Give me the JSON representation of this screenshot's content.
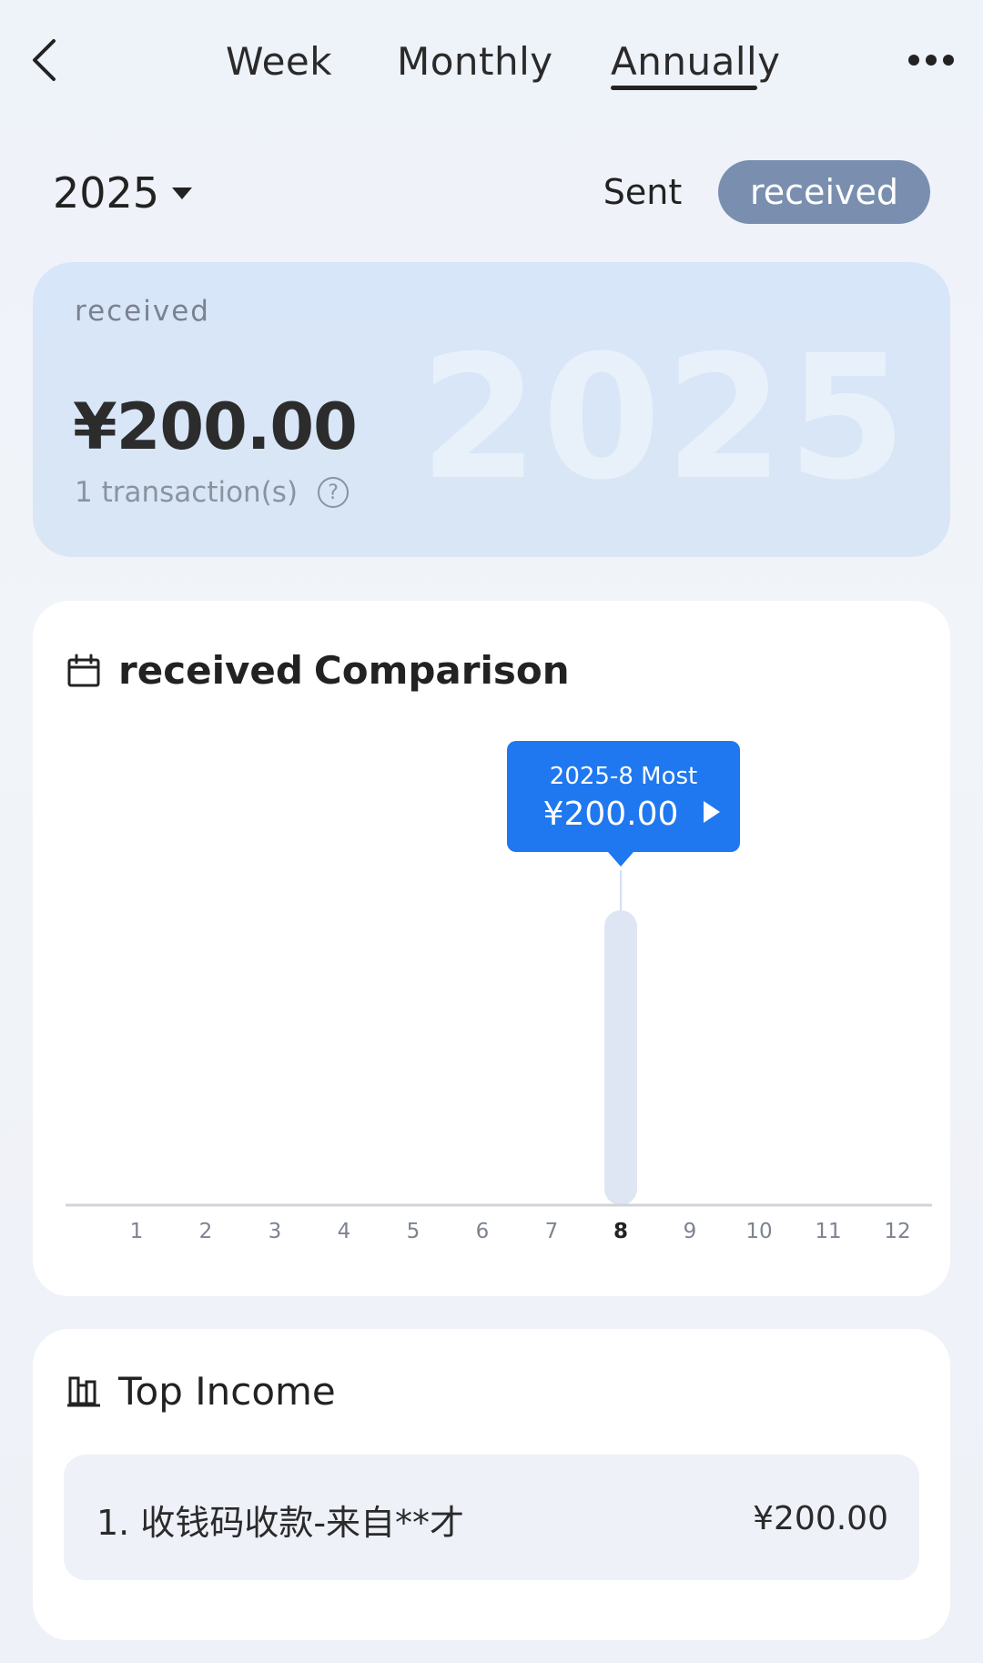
{
  "nav": {
    "tabs": [
      "Week",
      "Monthly",
      "Annually"
    ],
    "active_tab": "Annually",
    "back_icon": "chevron-left-icon",
    "more_icon": "more-dots-icon"
  },
  "filter": {
    "year": "2025",
    "toggle_sent": "Sent",
    "toggle_received": "received",
    "active_toggle": "received"
  },
  "summary": {
    "label": "received",
    "amount": "¥200.00",
    "count": "1 transaction(s)",
    "watermark": "2025",
    "help_icon": "?"
  },
  "comparison": {
    "title_prefix": "received",
    "title_suffix": "Comparison",
    "icon": "calendar-icon",
    "tooltip_line1": "2025-8 Most",
    "tooltip_line2": "¥200.00",
    "accent": "#1f78f0",
    "bar_color": "#dfe6f3"
  },
  "chart_data": {
    "type": "bar",
    "categories": [
      "1",
      "2",
      "3",
      "4",
      "5",
      "6",
      "7",
      "8",
      "9",
      "10",
      "11",
      "12"
    ],
    "values": [
      0,
      0,
      0,
      0,
      0,
      0,
      0,
      200,
      0,
      0,
      0,
      0
    ],
    "highlight_index": 7,
    "ylim": [
      0,
      200
    ],
    "grid": false
  },
  "top_income": {
    "title": "Top Income",
    "icon": "bar-chart-icon",
    "items": [
      {
        "name": "1. 收钱码收款-来自**才",
        "amount": "¥200.00"
      }
    ]
  }
}
